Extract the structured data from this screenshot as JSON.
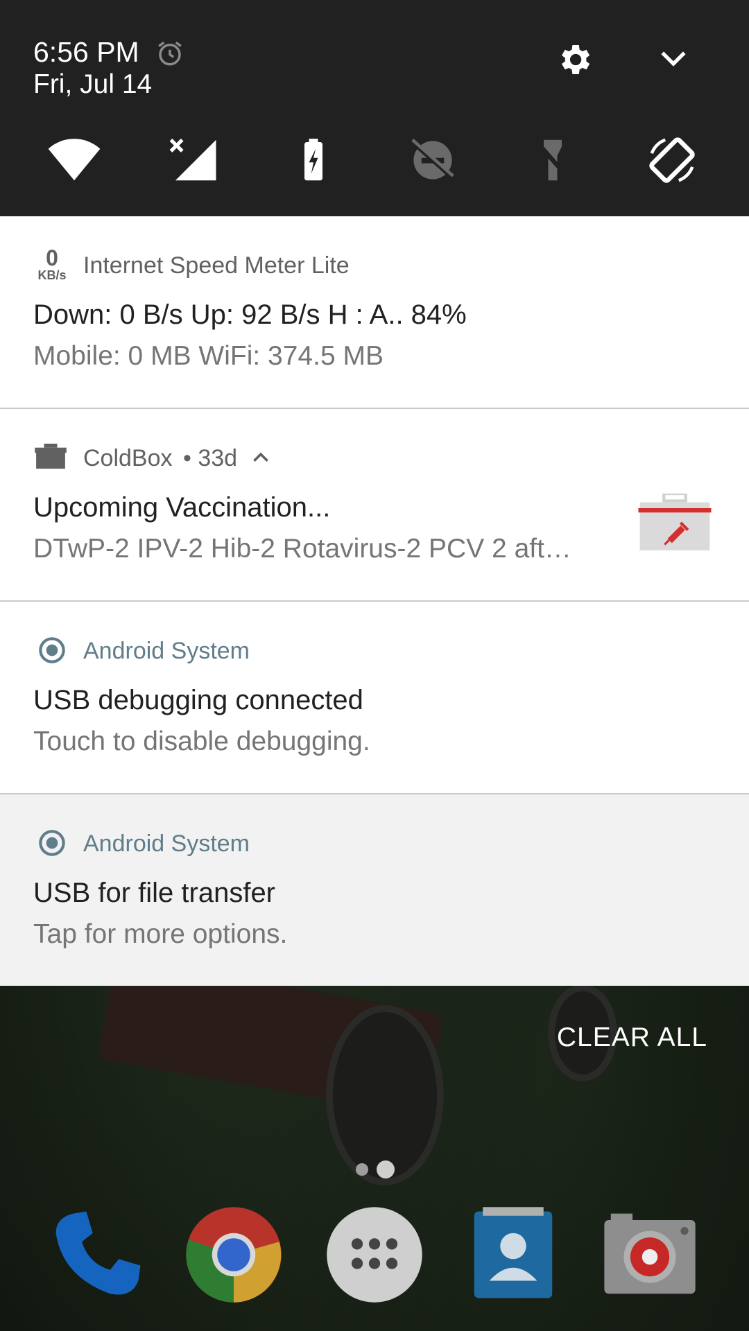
{
  "status": {
    "time": "6:56 PM",
    "date": "Fri, Jul 14",
    "icons": [
      "alarm-icon",
      "settings-icon",
      "expand-icon"
    ]
  },
  "quick_settings": {
    "tiles": [
      "wifi-icon",
      "mobile-data-off-icon",
      "battery-saver-icon",
      "do-not-disturb-off-icon",
      "flashlight-off-icon",
      "auto-rotate-icon"
    ]
  },
  "notifications": [
    {
      "app_badge_top": "0",
      "app_badge_bottom": "KB/s",
      "app": "Internet Speed Meter Lite",
      "title": "Down: 0 B/s   Up: 92 B/s   H : A.. 84%",
      "text": "Mobile: 0 MB   WiFi: 374.5 MB"
    },
    {
      "app": "ColdBox",
      "meta": "• 33d",
      "title": "Upcoming Vaccination...",
      "text": "DTwP-2 IPV-2 Hib-2 Rotavirus-2 PCV 2 aft…"
    },
    {
      "app": "Android System",
      "title": "USB debugging connected",
      "text": "Touch to disable debugging."
    },
    {
      "app": "Android System",
      "title": "USB for file transfer",
      "text": "Tap for more options."
    }
  ],
  "actions": {
    "clear_all": "CLEAR ALL"
  },
  "dock": [
    "phone-icon",
    "chrome-icon",
    "app-drawer-icon",
    "contacts-icon",
    "camera-icon"
  ],
  "colors": {
    "header_bg": "#212121",
    "system_app_color": "#607d8b",
    "coldbox_accent": "#d32f2f"
  }
}
